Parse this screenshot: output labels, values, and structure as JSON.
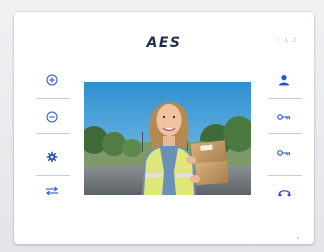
{
  "brand": {
    "logo_text": "AES"
  },
  "indicators": {
    "left": "○",
    "middle": "1",
    "right": "2"
  },
  "left_controls": [
    {
      "icon": "plus-circle-icon"
    },
    {
      "icon": "minus-circle-icon"
    },
    {
      "icon": "settings-icon"
    },
    {
      "icon": "transfer-arrows-icon"
    }
  ],
  "right_controls": [
    {
      "icon": "person-icon"
    },
    {
      "icon": "key-icon"
    },
    {
      "icon": "key-icon"
    },
    {
      "icon": "handset-icon"
    }
  ],
  "colors": {
    "accent": "#2a55c9",
    "body": "#ffffff",
    "divider": "#c9cdd4",
    "logo": "#1f2f4f"
  }
}
